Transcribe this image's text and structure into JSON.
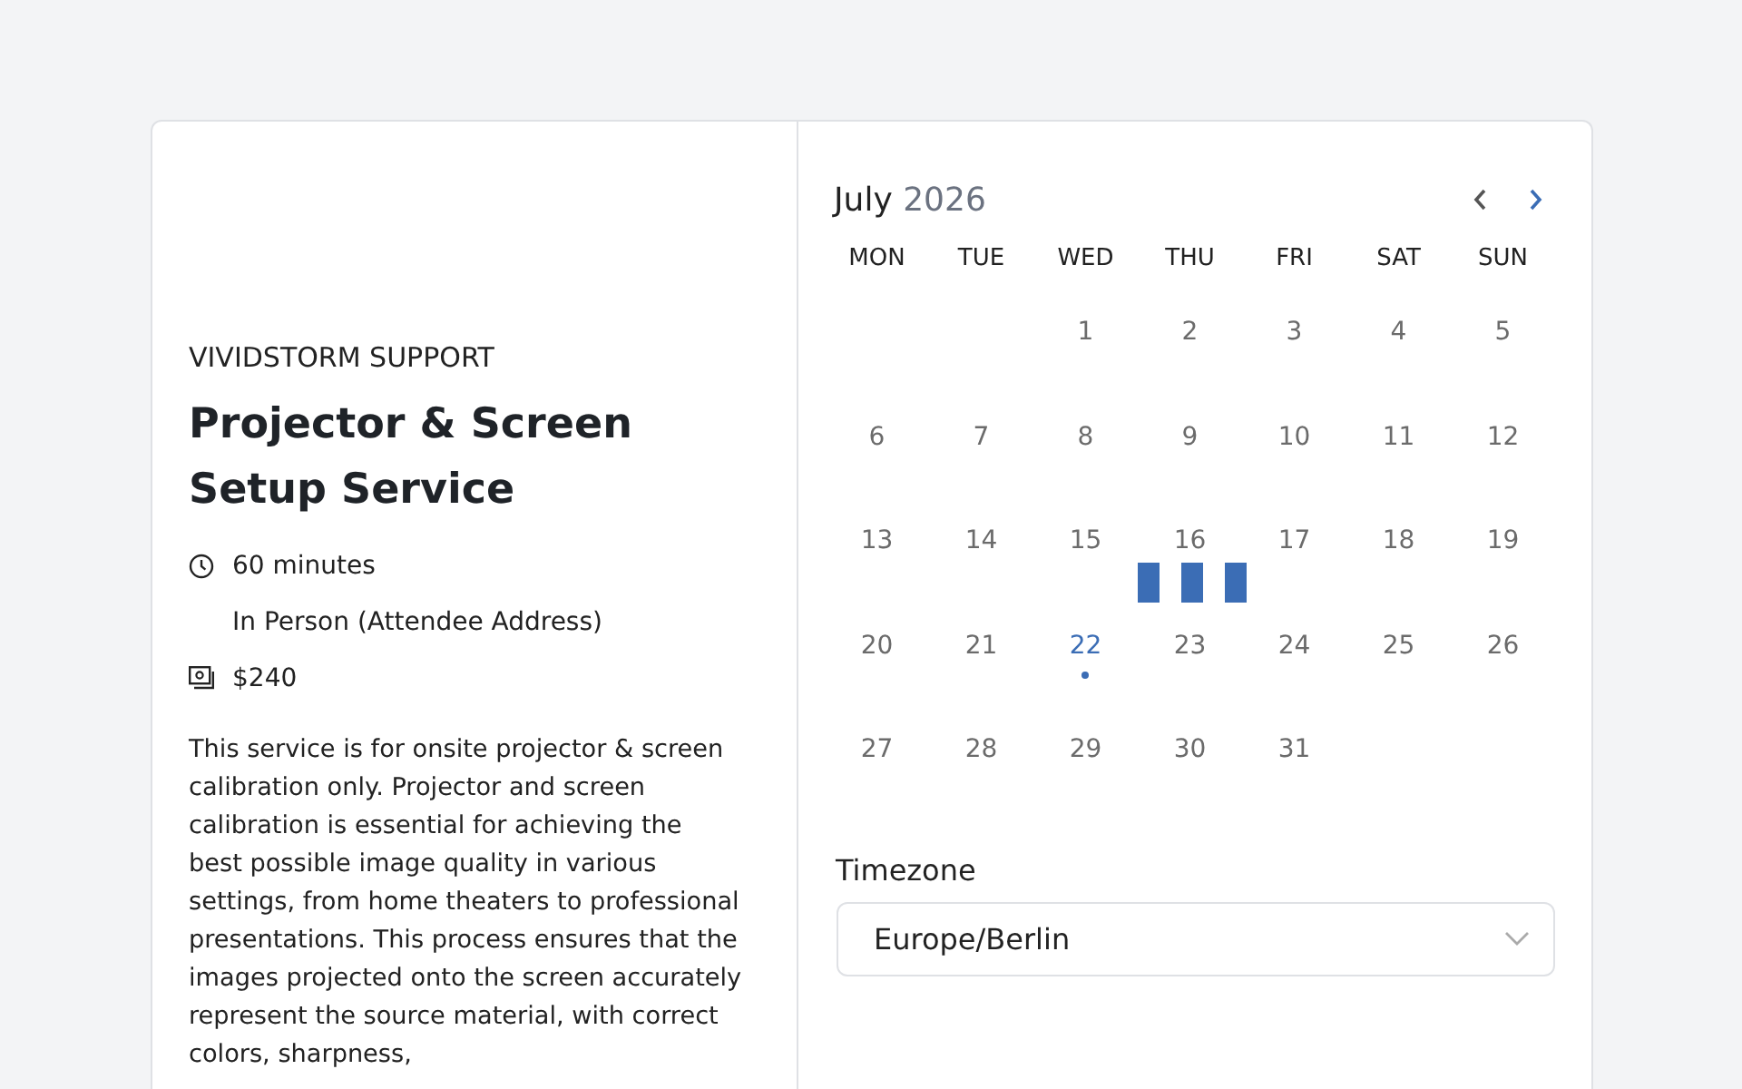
{
  "event": {
    "organizer": "VIVIDSTORM SUPPORT",
    "title": "Projector & Screen Setup Service",
    "details": [
      {
        "kind": "duration",
        "text": "60 minutes"
      },
      {
        "kind": "location",
        "text": "In Person (Attendee Address)"
      },
      {
        "kind": "price",
        "text": "$240"
      }
    ],
    "description": "This service is for onsite projector & screen calibration only. Projector and screen calibration is essential for achieving the best possible image quality in various settings, from home theaters to professional presentations. This process ensures that the images projected onto the screen accurately represent the source material, with correct colors, sharpness,"
  },
  "calendar": {
    "month": "July",
    "year": "2026",
    "prev_disabled": true,
    "next_disabled": false,
    "loading": true,
    "weekdays": [
      "MON",
      "TUE",
      "WED",
      "THU",
      "FRI",
      "SAT",
      "SUN"
    ],
    "weeks": [
      [
        {
          "kind": "blank"
        },
        {
          "kind": "blank"
        },
        {
          "kind": "day",
          "label": "1",
          "today": false
        },
        {
          "kind": "day",
          "label": "2",
          "today": false
        },
        {
          "kind": "day",
          "label": "3",
          "today": false
        },
        {
          "kind": "day",
          "label": "4",
          "today": false
        },
        {
          "kind": "day",
          "label": "5",
          "today": false
        }
      ],
      [
        {
          "kind": "day",
          "label": "6",
          "today": false
        },
        {
          "kind": "day",
          "label": "7",
          "today": false
        },
        {
          "kind": "day",
          "label": "8",
          "today": false
        },
        {
          "kind": "day",
          "label": "9",
          "today": false
        },
        {
          "kind": "day",
          "label": "10",
          "today": false
        },
        {
          "kind": "day",
          "label": "11",
          "today": false
        },
        {
          "kind": "day",
          "label": "12",
          "today": false
        }
      ],
      [
        {
          "kind": "day",
          "label": "13",
          "today": false
        },
        {
          "kind": "day",
          "label": "14",
          "today": false
        },
        {
          "kind": "day",
          "label": "15",
          "today": false
        },
        {
          "kind": "day",
          "label": "16",
          "today": false
        },
        {
          "kind": "day",
          "label": "17",
          "today": false
        },
        {
          "kind": "day",
          "label": "18",
          "today": false
        },
        {
          "kind": "day",
          "label": "19",
          "today": false
        }
      ],
      [
        {
          "kind": "day",
          "label": "20",
          "today": false
        },
        {
          "kind": "day",
          "label": "21",
          "today": false
        },
        {
          "kind": "day",
          "label": "22",
          "today": true
        },
        {
          "kind": "day",
          "label": "23",
          "today": false
        },
        {
          "kind": "day",
          "label": "24",
          "today": false
        },
        {
          "kind": "day",
          "label": "25",
          "today": false
        },
        {
          "kind": "day",
          "label": "26",
          "today": false
        }
      ],
      [
        {
          "kind": "day",
          "label": "27",
          "today": false
        },
        {
          "kind": "day",
          "label": "28",
          "today": false
        },
        {
          "kind": "day",
          "label": "29",
          "today": false
        },
        {
          "kind": "day",
          "label": "30",
          "today": false
        },
        {
          "kind": "day",
          "label": "31",
          "today": false
        },
        {
          "kind": "blank"
        },
        {
          "kind": "blank"
        }
      ]
    ]
  },
  "timezone": {
    "label": "Timezone",
    "value": "Europe/Berlin"
  }
}
